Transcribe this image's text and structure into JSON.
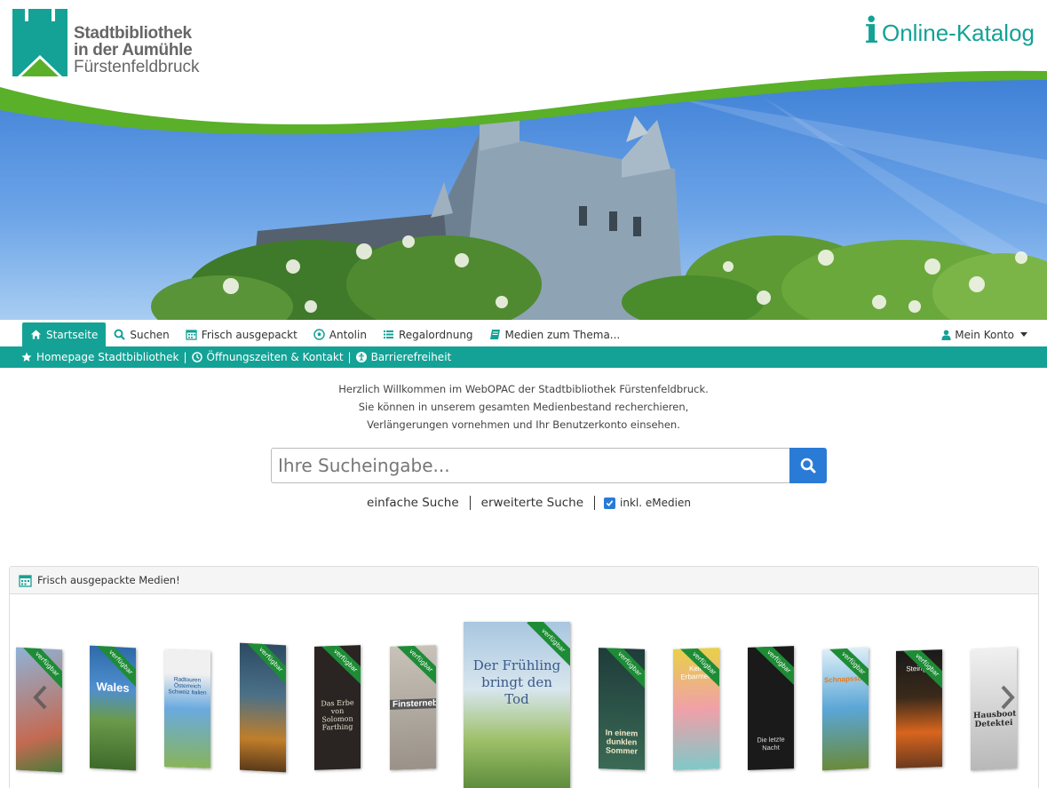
{
  "header": {
    "logo_line1": "Stadtbibliothek",
    "logo_line2": "in der Aumühle",
    "logo_line3": "Fürstenfeldbruck",
    "katalog_icon": "i",
    "katalog_label": "Online-Katalog"
  },
  "nav": {
    "items": [
      {
        "label": "Startseite",
        "icon": "home-icon"
      },
      {
        "label": "Suchen",
        "icon": "search-icon"
      },
      {
        "label": "Frisch ausgepackt",
        "icon": "calendar-icon"
      },
      {
        "label": "Antolin",
        "icon": "soccer-ball-icon"
      },
      {
        "label": "Regalordnung",
        "icon": "list-icon"
      },
      {
        "label": "Medien zum Thema...",
        "icon": "book-icon"
      }
    ],
    "account_label": "Mein Konto"
  },
  "subnav": {
    "items": [
      {
        "label": "Homepage Stadtbibliothek",
        "icon": "star-icon"
      },
      {
        "label": "Öffnungszeiten & Kontakt",
        "icon": "clock-icon"
      },
      {
        "label": "Barrierefreiheit",
        "icon": "accessibility-icon"
      }
    ],
    "separator": "|"
  },
  "welcome": {
    "line1": "Herzlich Willkommen im WebOPAC der Stadtbibliothek Fürstenfeldbruck.",
    "line2": "Sie können in unserem gesamten Medienbestand recherchieren,",
    "line3": "Verlängerungen vornehmen und Ihr Benutzerkonto einsehen."
  },
  "search": {
    "placeholder": "Ihre Sucheingabe...",
    "value": "",
    "simple_label": "einfache Suche",
    "advanced_label": "erweiterte Suche",
    "emedien_label": "inkl. eMedien",
    "emedien_checked": true
  },
  "panel": {
    "title": "Frisch ausgepackte Medien!",
    "ribbon_label": "verfügbar",
    "books": [
      {
        "title": "",
        "color": "#7a9bc4"
      },
      {
        "title": "Wales",
        "color": "#2f6aa8"
      },
      {
        "title": "Radtouren Österreich Schweiz Italien",
        "color": "#3f7fbf"
      },
      {
        "title": "",
        "color": "#3c5868"
      },
      {
        "title": "Das Erbe von Solomon Farthing",
        "color": "#2a2522"
      },
      {
        "title": "Finsternebel",
        "color": "#b8b2a8"
      },
      {
        "title": "Der Frühling bringt den Tod",
        "color": "#8fb0c8"
      },
      {
        "title": "In einem dunklen Sommer",
        "color": "#1f3c3a"
      },
      {
        "title": "Kein Erbarmen",
        "color": "#e8d04a"
      },
      {
        "title": "Die letzte Nacht",
        "color": "#1a1a1a"
      },
      {
        "title": "Schnapsschoule",
        "color": "#5aa6d6"
      },
      {
        "title": "Steingut",
        "color": "#6a3a1e"
      },
      {
        "title": "Hausboot Detektei",
        "color": "#d8d8d8"
      }
    ]
  },
  "colors": {
    "accent": "#14a296",
    "green": "#5ab028",
    "search_button": "#2a7bd6",
    "ribbon": "#1e8c36"
  }
}
